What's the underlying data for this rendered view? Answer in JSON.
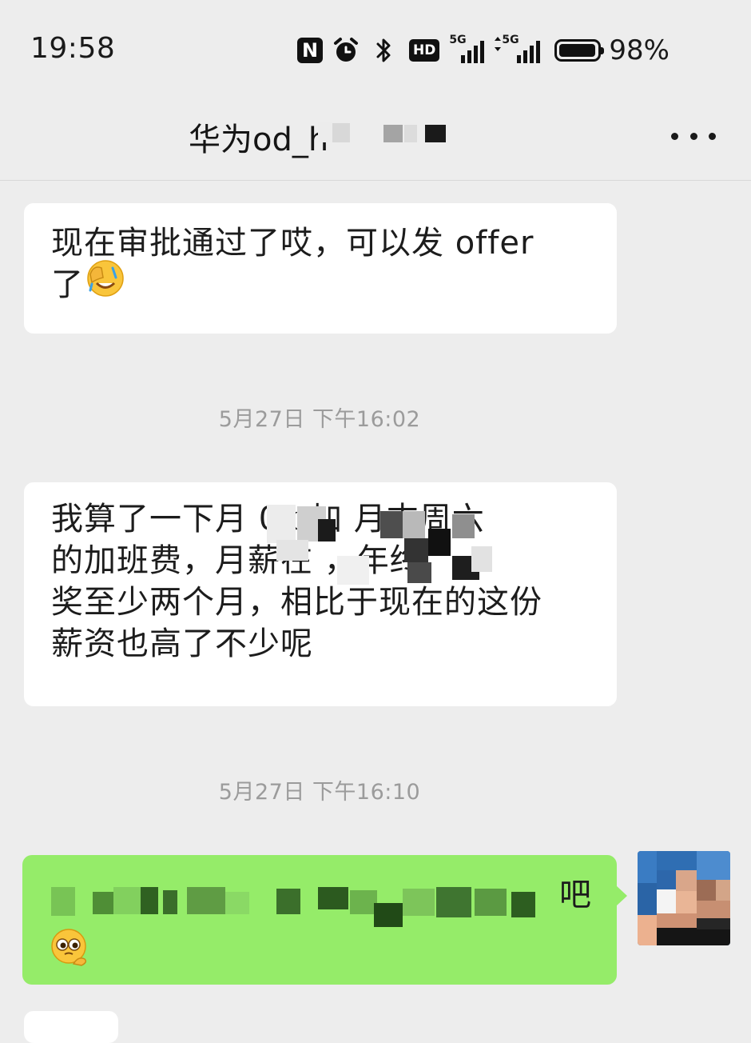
{
  "status_bar": {
    "time": "19:58",
    "icons": [
      "nfc-icon",
      "alarm-icon",
      "bluetooth-icon",
      "hd-voice-icon",
      "signal-5g-icon",
      "signal-5g-data-icon",
      "battery-icon"
    ],
    "hd_label": "HD",
    "network_label": "5G",
    "battery_level": 0.98,
    "battery_text": "98%"
  },
  "header": {
    "title": "华为od_h",
    "more_icon": "more-dots-icon"
  },
  "messages": [
    {
      "direction": "incoming",
      "text": "现在审批通过了哎，可以发 offer\n了",
      "emoji": "facepalm-laugh-emoji"
    },
    {
      "type": "timestamp",
      "text": "5月27日 下午16:02"
    },
    {
      "direction": "incoming",
      "text": "我算了一下月 0k 加 月末周六\n的加班费，月薪在 ，年终\n奖至少两个月，相比于现在的这份\n薪资也高了不少呢",
      "note": "partially pixelated"
    },
    {
      "type": "timestamp",
      "text": "5月27日 下午16:10"
    },
    {
      "direction": "outgoing",
      "text": "吧",
      "emoji": "pleading-thinking-emoji",
      "note": "mostly pixelated"
    }
  ],
  "colors": {
    "background": "#ededed",
    "incoming_bubble": "#ffffff",
    "outgoing_bubble": "#95ec69",
    "timestamp": "#9b9b9b"
  }
}
